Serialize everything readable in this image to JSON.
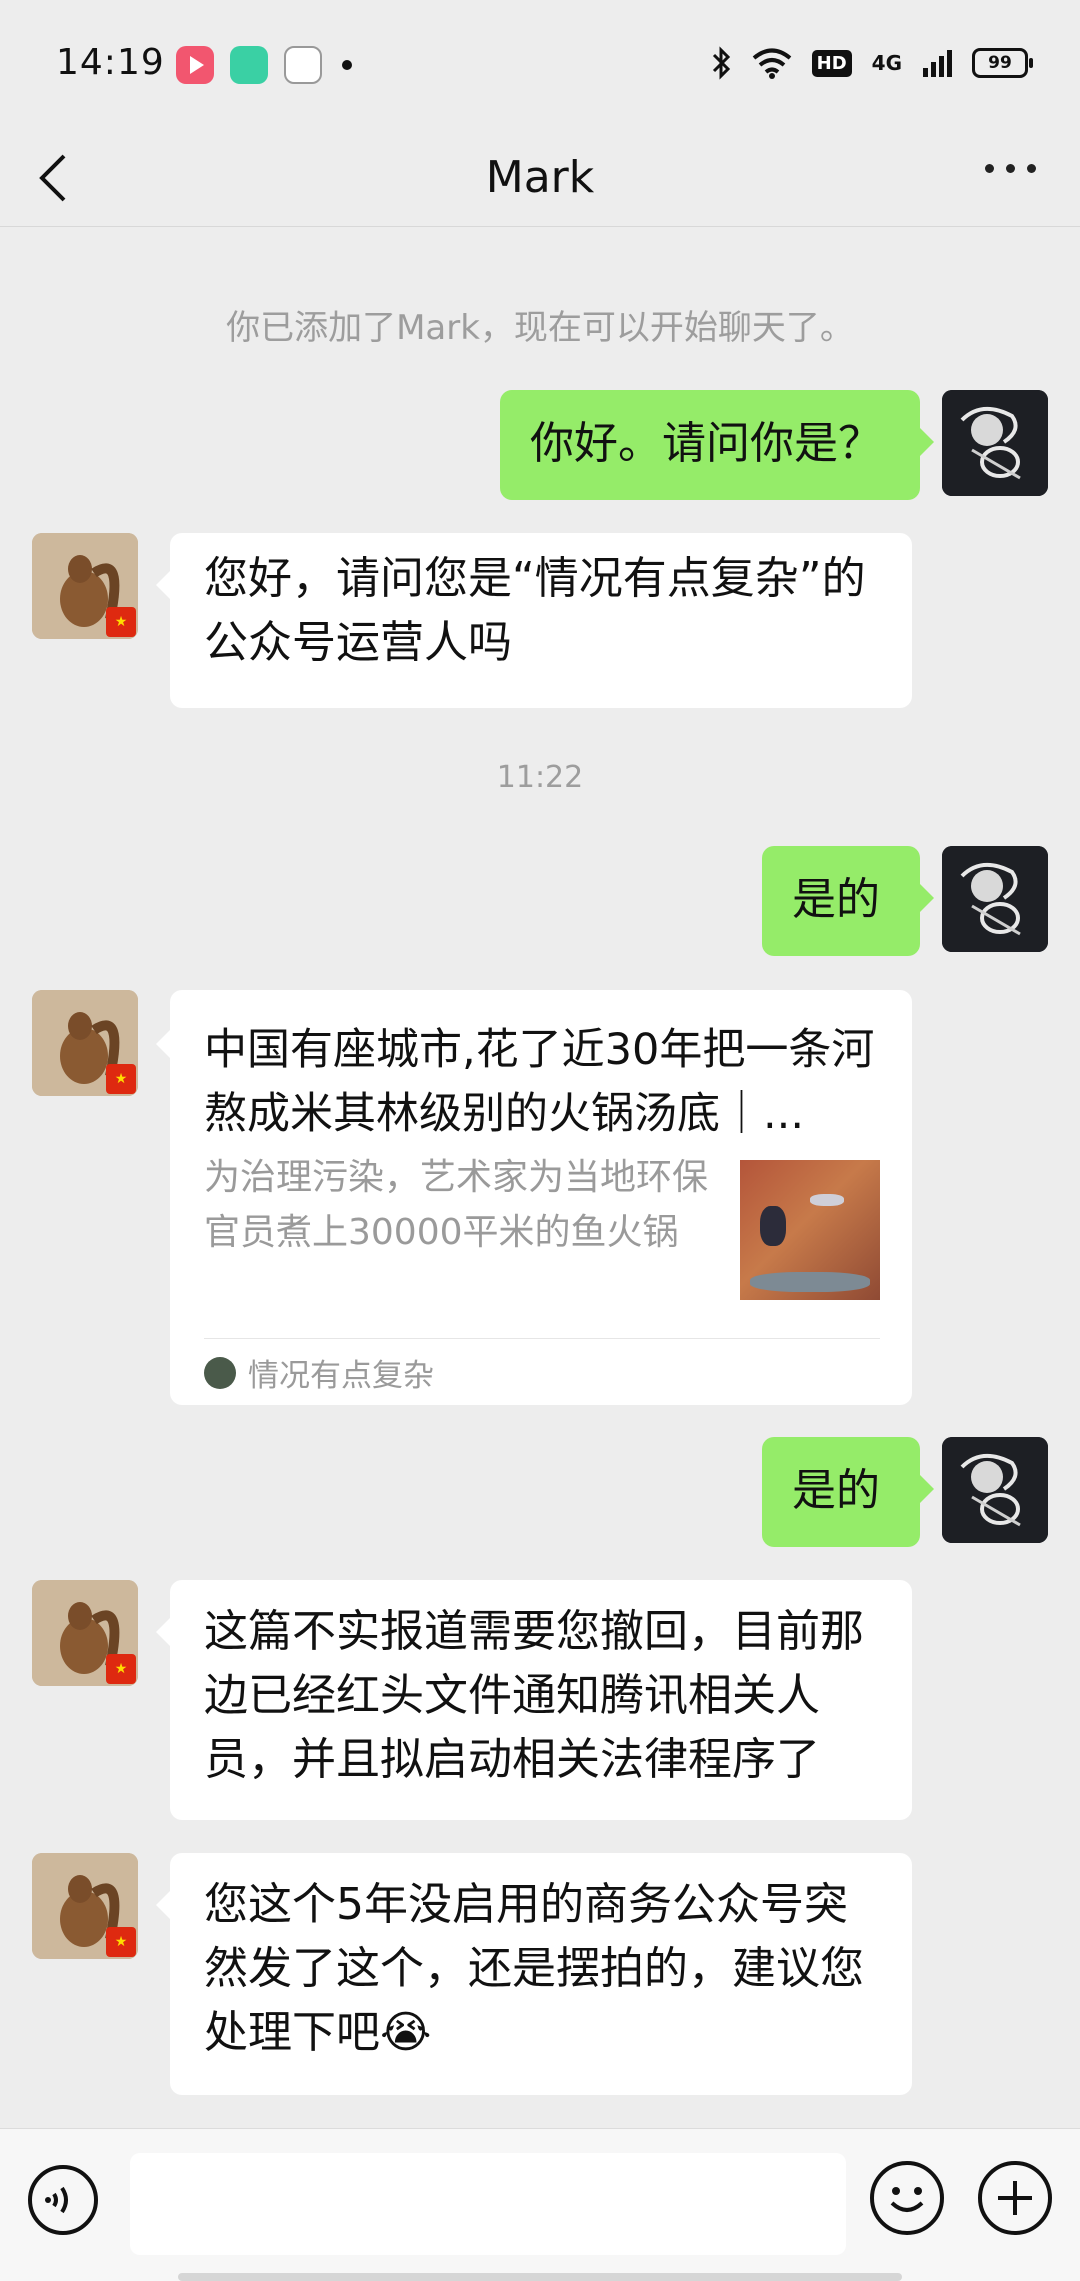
{
  "status_bar": {
    "time": "14:19",
    "network": "4G",
    "hd_label": "HD",
    "battery": "99"
  },
  "header": {
    "title": "Mark"
  },
  "system_tip": "你已添加了Mark，现在可以开始聊天了。",
  "timestamp": "11:22",
  "messages": [
    {
      "side": "me",
      "text": "你好。请问你是？"
    },
    {
      "side": "them",
      "text": "您好，请问您是“情况有点复杂”的公众号运营人吗"
    },
    {
      "side": "me",
      "text": "是的"
    },
    {
      "side": "them",
      "type": "link_card",
      "title": "中国有座城市,花了近30年把一条河熬成米其林级别的火锅汤底｜...",
      "description": "为治理污染，艺术家为当地环保官员煮上30000平米的鱼火锅",
      "source": "情况有点复杂"
    },
    {
      "side": "me",
      "text": "是的"
    },
    {
      "side": "them",
      "text": "这篇不实报道需要您撤回，目前那边已经红头文件通知腾讯相关人员，并且拟启动相关法律程序了"
    },
    {
      "side": "them",
      "text": "您这个5年没启用的商务公众号突然发了这个，还是摆拍的，建议您处理下吧😭"
    }
  ],
  "colors": {
    "background": "#ededed",
    "my_bubble": "#95ec69",
    "their_bubble": "#ffffff",
    "secondary_text": "#9d9d9d"
  },
  "icons": [
    "back-chevron-icon",
    "more-icon",
    "voice-icon",
    "emoji-icon",
    "plus-icon"
  ]
}
